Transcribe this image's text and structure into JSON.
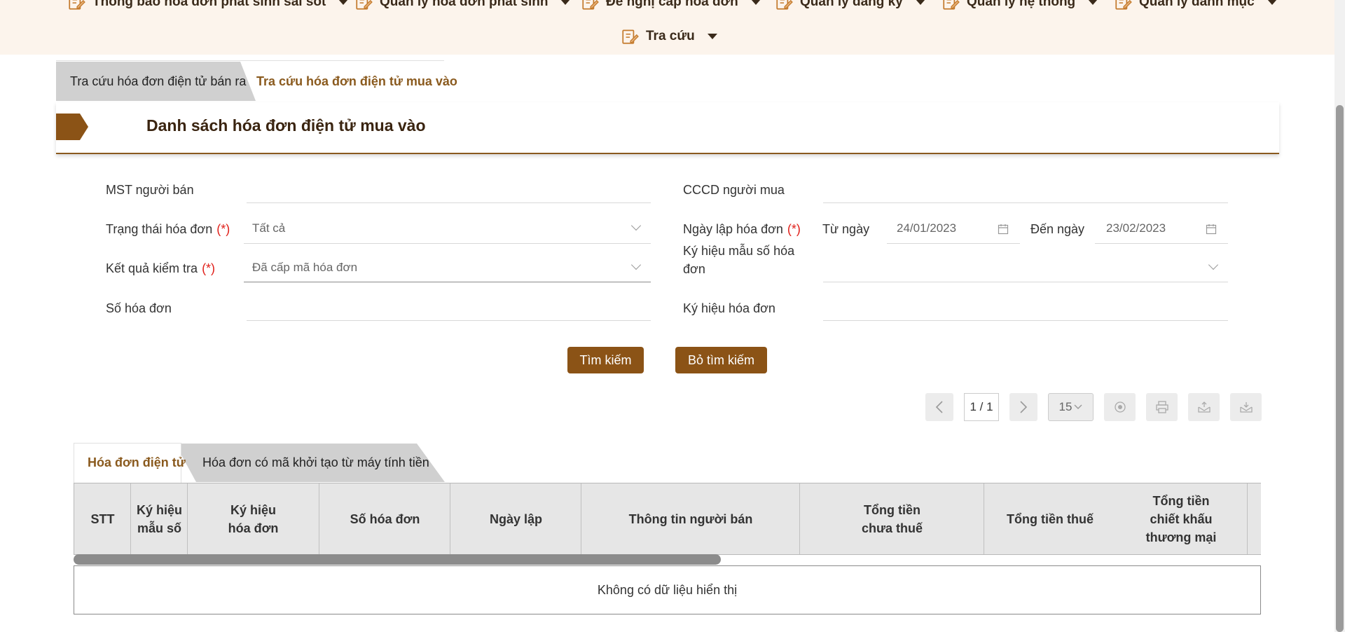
{
  "nav": {
    "items": [
      {
        "label": "Thông báo hóa đơn phát sinh sai sót"
      },
      {
        "label": "Quản lý hóa đơn phát sinh"
      },
      {
        "label": "Đề nghị cấp hóa đơn"
      },
      {
        "label": "Quản lý đăng ký"
      },
      {
        "label": "Quản lý hệ thống"
      },
      {
        "label": "Quản lý danh mục"
      },
      {
        "label": "Tra cứu"
      }
    ]
  },
  "page_tabs": {
    "sold": "Tra cứu hóa đơn điện tử bán ra",
    "purchased": "Tra cứu hóa đơn điện tử mua vào"
  },
  "section": {
    "title": "Danh sách hóa đơn điện tử mua vào"
  },
  "form": {
    "seller_tax_code": {
      "label": "MST người bán",
      "value": ""
    },
    "buyer_id": {
      "label": "CCCD người mua",
      "value": ""
    },
    "invoice_status": {
      "label": "Trạng thái hóa đơn",
      "required": "(*)",
      "value": "Tất cả"
    },
    "invoice_date": {
      "label": "Ngày lập hóa đơn",
      "required": "(*)",
      "from_label": "Từ ngày",
      "from": "24/01/2023",
      "to_label": "Đến ngày",
      "to": "23/02/2023"
    },
    "check_result": {
      "label": "Kết quả kiểm tra",
      "required": "(*)",
      "value": "Đã cấp mã hóa đơn"
    },
    "template_symbol": {
      "label": "Ký hiệu mẫu số hóa đơn",
      "value": ""
    },
    "invoice_number": {
      "label": "Số hóa đơn",
      "value": ""
    },
    "invoice_symbol": {
      "label": "Ký hiệu hóa đơn",
      "value": ""
    },
    "search_button": "Tìm kiếm",
    "clear_button": "Bỏ tìm kiếm"
  },
  "pagination": {
    "page": "1 / 1",
    "page_size": "15"
  },
  "grid_tabs": {
    "einvoice": "Hóa đơn điện tử",
    "cash_register": "Hóa đơn có mã khởi tạo từ máy tính tiền"
  },
  "table": {
    "columns": [
      "STT",
      "Ký hiệu\nmẫu số",
      "Ký hiệu\nhóa đơn",
      "Số hóa đơn",
      "Ngày lập",
      "Thông tin người bán",
      "Tổng tiền\nchưa thuế",
      "Tổng tiền thuế",
      "Tổng tiền\nchiết khấu\nthương mại"
    ],
    "empty_message": "Không có dữ liệu hiển thị"
  },
  "colors": {
    "accent": "#8b5316",
    "nav_bg": "#fcf4ec",
    "required": "#e0201a"
  }
}
